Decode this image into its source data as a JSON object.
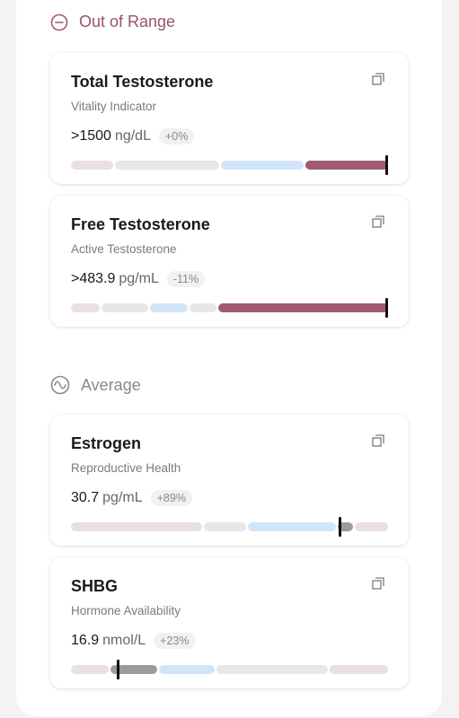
{
  "colors": {
    "out_of_range": "#a05a74",
    "average_dark": "#9b9b9b",
    "pink_light": "#eadfe3",
    "grey_light": "#e7e7e7",
    "blue_light": "#d2e5f7",
    "marker": "#111111"
  },
  "sections": {
    "out_of_range": {
      "label": "Out of Range",
      "icon": "minus-circle-icon"
    },
    "average": {
      "label": "Average",
      "icon": "wave-circle-icon"
    }
  },
  "cards": [
    {
      "title": "Total Testosterone",
      "subtitle": "Vitality Indicator",
      "value": ">1500",
      "unit": "ng/dL",
      "change": "+0%",
      "marker_position": 1.0,
      "active_segment": 3
    },
    {
      "title": "Free Testosterone",
      "subtitle": "Active Testosterone",
      "value": ">483.9",
      "unit": "pg/mL",
      "change": "-11%",
      "marker_position": 1.0,
      "active_segment": 4
    },
    {
      "title": "Estrogen",
      "subtitle": "Reproductive Health",
      "value": "30.7",
      "unit": "pg/mL",
      "change": "+89%",
      "marker_position": 0.85,
      "active_segment": 3
    },
    {
      "title": "SHBG",
      "subtitle": "Hormone Availability",
      "value": "16.9",
      "unit": "nmol/L",
      "change": "+23%",
      "marker_position": 0.15,
      "active_segment": 1
    }
  ]
}
